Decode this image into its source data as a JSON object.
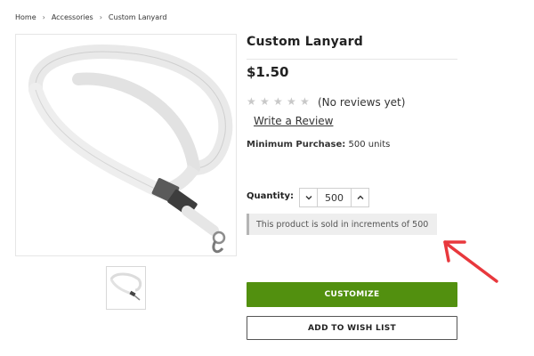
{
  "breadcrumb": {
    "items": [
      "Home",
      "Accessories",
      "Custom Lanyard"
    ],
    "separator": "›"
  },
  "product": {
    "title": "Custom Lanyard",
    "price": "$1.50",
    "rating_stars": 0,
    "rating_max": 5,
    "no_reviews": "(No reviews yet)",
    "write_review": "Write a Review",
    "min_purchase_label": "Minimum Purchase:",
    "min_purchase_value": "500 units"
  },
  "quantity": {
    "label": "Quantity:",
    "value": "500",
    "decrement_icon": "chevron-down-icon",
    "increment_icon": "chevron-up-icon"
  },
  "notice": {
    "text": "This product is sold in increments of 500"
  },
  "actions": {
    "customize_label": "CUSTOMIZE",
    "wishlist_label": "ADD TO WISH LIST"
  },
  "colors": {
    "customize_bg": "#52900f",
    "annotation_arrow": "#e8383d",
    "star_empty": "#c8c8c8"
  }
}
